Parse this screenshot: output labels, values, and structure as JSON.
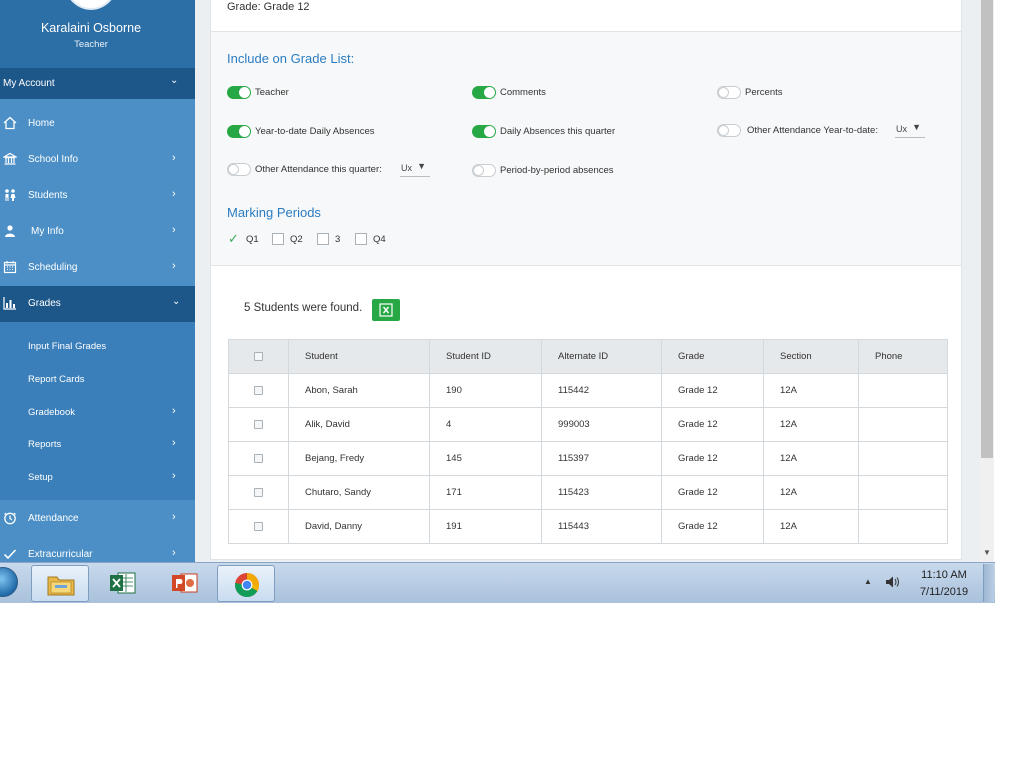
{
  "profile": {
    "name": "Karalaini Osborne",
    "role": "Teacher"
  },
  "sidebar": {
    "my_account": "My Account",
    "items": [
      {
        "label": "Home",
        "icon": "home-icon"
      },
      {
        "label": "School Info",
        "icon": "bank-icon"
      },
      {
        "label": "Students",
        "icon": "people-icon"
      },
      {
        "label": "My Info",
        "icon": "user-info-icon"
      },
      {
        "label": "Scheduling",
        "icon": "calendar-icon"
      },
      {
        "label": "Grades",
        "icon": "bar-chart-icon"
      },
      {
        "label": "Attendance",
        "icon": "clock-icon"
      },
      {
        "label": "Extracurricular",
        "icon": "check-icon"
      }
    ],
    "grades_sub": [
      {
        "label": "Input Final Grades"
      },
      {
        "label": "Report Cards"
      },
      {
        "label": "Gradebook"
      },
      {
        "label": "Reports"
      },
      {
        "label": "Setup"
      }
    ]
  },
  "grade_line": "Grade: Grade 12",
  "include": {
    "title": "Include on Grade List:",
    "options": [
      {
        "label": "Teacher",
        "on": true
      },
      {
        "label": "Comments",
        "on": true
      },
      {
        "label": "Percents",
        "on": false
      },
      {
        "label": "Year-to-date Daily Absences",
        "on": true
      },
      {
        "label": "Daily Absences this quarter",
        "on": true
      },
      {
        "label": "Other Attendance Year-to-date:",
        "on": false
      },
      {
        "label": "Other Attendance this quarter:",
        "on": false
      },
      {
        "label": "Period-by-period absences",
        "on": false
      }
    ],
    "select_ytd_value": "Ux",
    "select_quarter_value": "Ux"
  },
  "marking_periods": {
    "title": "Marking Periods",
    "items": [
      {
        "label": "Q1",
        "checked": true
      },
      {
        "label": "Q2",
        "checked": false
      },
      {
        "label": "3",
        "checked": false
      },
      {
        "label": "Q4",
        "checked": false
      }
    ]
  },
  "results": {
    "found_text": "5 Students were found.",
    "columns": [
      "Student",
      "Student ID",
      "Alternate ID",
      "Grade",
      "Section",
      "Phone"
    ],
    "rows": [
      {
        "student": "Abon, Sarah",
        "student_id": "190",
        "alternate_id": "115442",
        "grade": "Grade 12",
        "section": "12A",
        "phone": ""
      },
      {
        "student": "Alik, David",
        "student_id": "4",
        "alternate_id": "999003",
        "grade": "Grade 12",
        "section": "12A",
        "phone": ""
      },
      {
        "student": "Bejang, Fredy",
        "student_id": "145",
        "alternate_id": "115397",
        "grade": "Grade 12",
        "section": "12A",
        "phone": ""
      },
      {
        "student": "Chutaro, Sandy",
        "student_id": "171",
        "alternate_id": "115423",
        "grade": "Grade 12",
        "section": "12A",
        "phone": ""
      },
      {
        "student": "David, Danny",
        "student_id": "191",
        "alternate_id": "115443",
        "grade": "Grade 12",
        "section": "12A",
        "phone": ""
      }
    ]
  },
  "taskbar": {
    "time": "11:10 AM",
    "date": "7/11/2019",
    "apps": [
      "file-explorer-icon",
      "excel-icon",
      "powerpoint-icon",
      "chrome-icon"
    ]
  },
  "colors": {
    "sidebar": "#4b8fc6",
    "sidebar_active": "#1d5688",
    "accent": "#2a7cc1",
    "toggle_on": "#27a845"
  }
}
